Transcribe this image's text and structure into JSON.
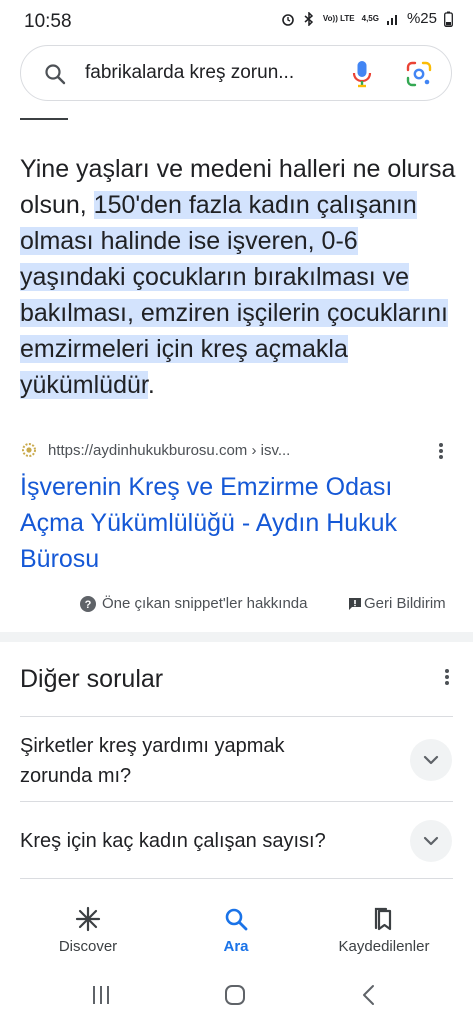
{
  "status_bar": {
    "time": "10:58",
    "network": "4,5G",
    "volte": "Vo)) LTE",
    "battery": "%25"
  },
  "search": {
    "query": "fabrikalarda kreş zorun..."
  },
  "snippet": {
    "lead": "Yine yaşları ve medeni halleri ne olursa olsun, ",
    "highlight": "150'den fazla kadın çalışanın olması halinde ise işveren, 0-6 yaşındaki çocukların bırakılması ve bakılması, emziren işçilerin çocuklarını emzirmeleri için kreş açmakla yükümlüdür",
    "tail": "."
  },
  "source": {
    "url": "https://aydinhukukburosu.com › isv..."
  },
  "result": {
    "title": "İşverenin Kreş ve Emzirme Odası Açma Yükümlülüğü - Aydın Hukuk Bürosu"
  },
  "snippet_footer": {
    "about": "Öne çıkan snippet'ler hakkında",
    "feedback": "Geri Bildirim"
  },
  "related": {
    "title": "Diğer sorular",
    "questions": [
      "Şirketler kreş yardımı yapmak zorunda mı?",
      "Kreş için kaç kadın çalışan sayısı?"
    ]
  },
  "bottom_nav": {
    "discover": "Discover",
    "search": "Ara",
    "saved": "Kaydedilenler"
  },
  "colors": {
    "accent": "#1a73e8",
    "link": "#1558d6",
    "highlight": "#d3e3fd"
  }
}
